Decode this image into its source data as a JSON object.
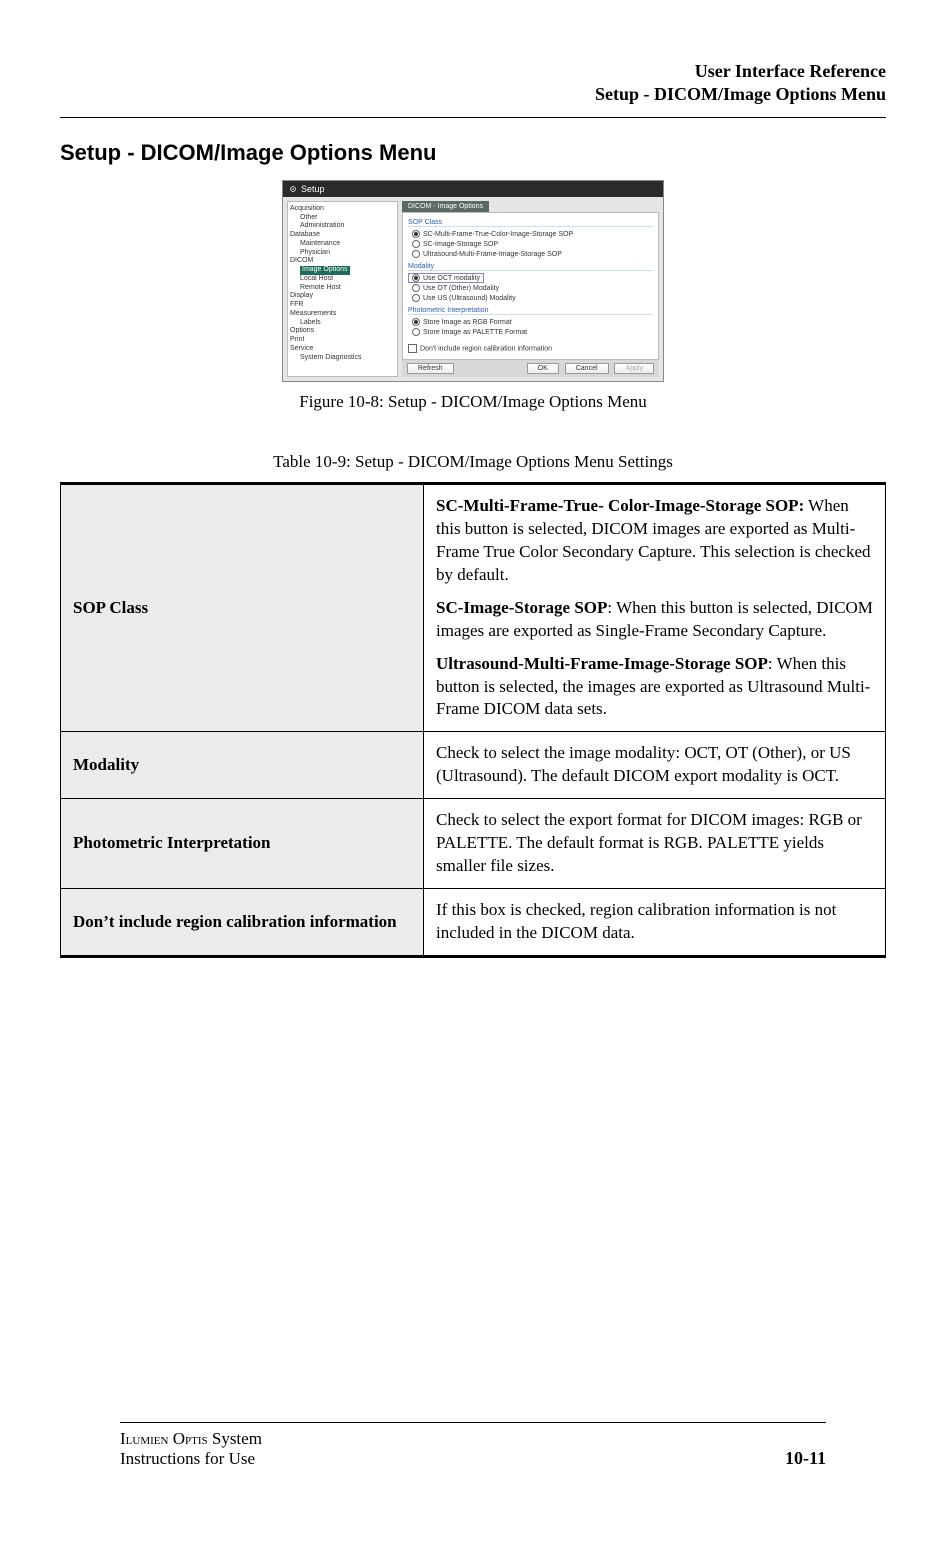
{
  "header": {
    "line1": "User Interface Reference",
    "line2": "Setup - DICOM/Image Options Menu"
  },
  "section_title": "Setup - DICOM/Image Options Menu",
  "figure": {
    "caption": "Figure 10-8:  Setup - DICOM/Image Options Menu",
    "window_title": "Setup",
    "tab_title": "DICOM - Image Options",
    "tree": {
      "items": [
        {
          "t": "Acquisition",
          "c": "ind0"
        },
        {
          "t": "Other",
          "c": "ind1"
        },
        {
          "t": "Administration",
          "c": "ind1"
        },
        {
          "t": "Database",
          "c": "ind0"
        },
        {
          "t": "Maintenance",
          "c": "ind1"
        },
        {
          "t": "Physician",
          "c": "ind1"
        },
        {
          "t": "DICOM",
          "c": "ind0"
        },
        {
          "t": "Image Options",
          "c": "ind1 sel"
        },
        {
          "t": "Local Host",
          "c": "ind1"
        },
        {
          "t": "Remote Host",
          "c": "ind1"
        },
        {
          "t": "Display",
          "c": "ind0"
        },
        {
          "t": "FFR",
          "c": "ind0"
        },
        {
          "t": "Measurements",
          "c": "ind0"
        },
        {
          "t": "Labels",
          "c": "ind1"
        },
        {
          "t": "Options",
          "c": "ind0"
        },
        {
          "t": "Print",
          "c": "ind0"
        },
        {
          "t": "Service",
          "c": "ind0"
        },
        {
          "t": "System Diagnostics",
          "c": "ind1"
        }
      ]
    },
    "groups": {
      "sop": {
        "title": "SOP Class",
        "opts": [
          {
            "label": "SC-Multi-Frame-True-Color-Image-Storage SOP",
            "checked": true
          },
          {
            "label": "SC-Image-Storage SOP",
            "checked": false
          },
          {
            "label": "Ultrasound-Multi-Frame-Image-Storage SOP",
            "checked": false
          }
        ]
      },
      "modality": {
        "title": "Modality",
        "opts": [
          {
            "label": "Use OCT modality",
            "checked": true,
            "boxed": true
          },
          {
            "label": "Use OT (Other) Modality",
            "checked": false
          },
          {
            "label": "Use US (Ultrasound) Modality",
            "checked": false
          }
        ]
      },
      "photo": {
        "title": "Photometric Interpretation",
        "opts": [
          {
            "label": "Store Image as RGB Format",
            "checked": true
          },
          {
            "label": "Store Image as PALETTE Format",
            "checked": false
          }
        ]
      },
      "checkbox_label": "Don't include region calibration information"
    },
    "buttons": {
      "refresh": "Refresh",
      "ok": "OK",
      "cancel": "Cancel",
      "apply": "Apply"
    }
  },
  "table": {
    "caption": "Table 10-9:  Setup - DICOM/Image Options Menu Settings",
    "rows": [
      {
        "name": "SOP Class",
        "blocks": [
          {
            "bold": "SC-Multi-Frame-True- Color-Image-Storage SOP:",
            "rest": " When this button is selected, DICOM images are exported as Multi-Frame True Color Secondary Capture. This selection is checked by default."
          },
          {
            "bold": "SC-Image-Storage SOP",
            "rest": ": When this button is selected, DICOM images are exported as Single-Frame Secondary Capture."
          },
          {
            "bold": "Ultrasound-Multi-Frame-Image-Storage SOP",
            "rest": ": When this button is selected, the images are exported as Ultrasound Multi-Frame DICOM data sets."
          }
        ]
      },
      {
        "name": "Modality",
        "blocks": [
          {
            "bold": "",
            "rest": "Check to select the image modality: OCT, OT (Other), or US (Ultrasound). The default DICOM export modality is OCT."
          }
        ]
      },
      {
        "name": "Photometric Interpretation",
        "blocks": [
          {
            "bold": "",
            "rest": "Check to select the export format for DICOM images:  RGB or PALETTE. The default format is RGB. PALETTE yields smaller file sizes."
          }
        ]
      },
      {
        "name": "Don’t include region calibration information",
        "blocks": [
          {
            "bold": "",
            "rest": "If this box is checked, region calibration information is not included in the DICOM data."
          }
        ]
      }
    ]
  },
  "footer": {
    "line1_a": "I",
    "line1_b": "lumien",
    "line1_c": " O",
    "line1_d": "ptis",
    "line1_e": " System",
    "line2": "Instructions for Use",
    "page": "10-11"
  }
}
